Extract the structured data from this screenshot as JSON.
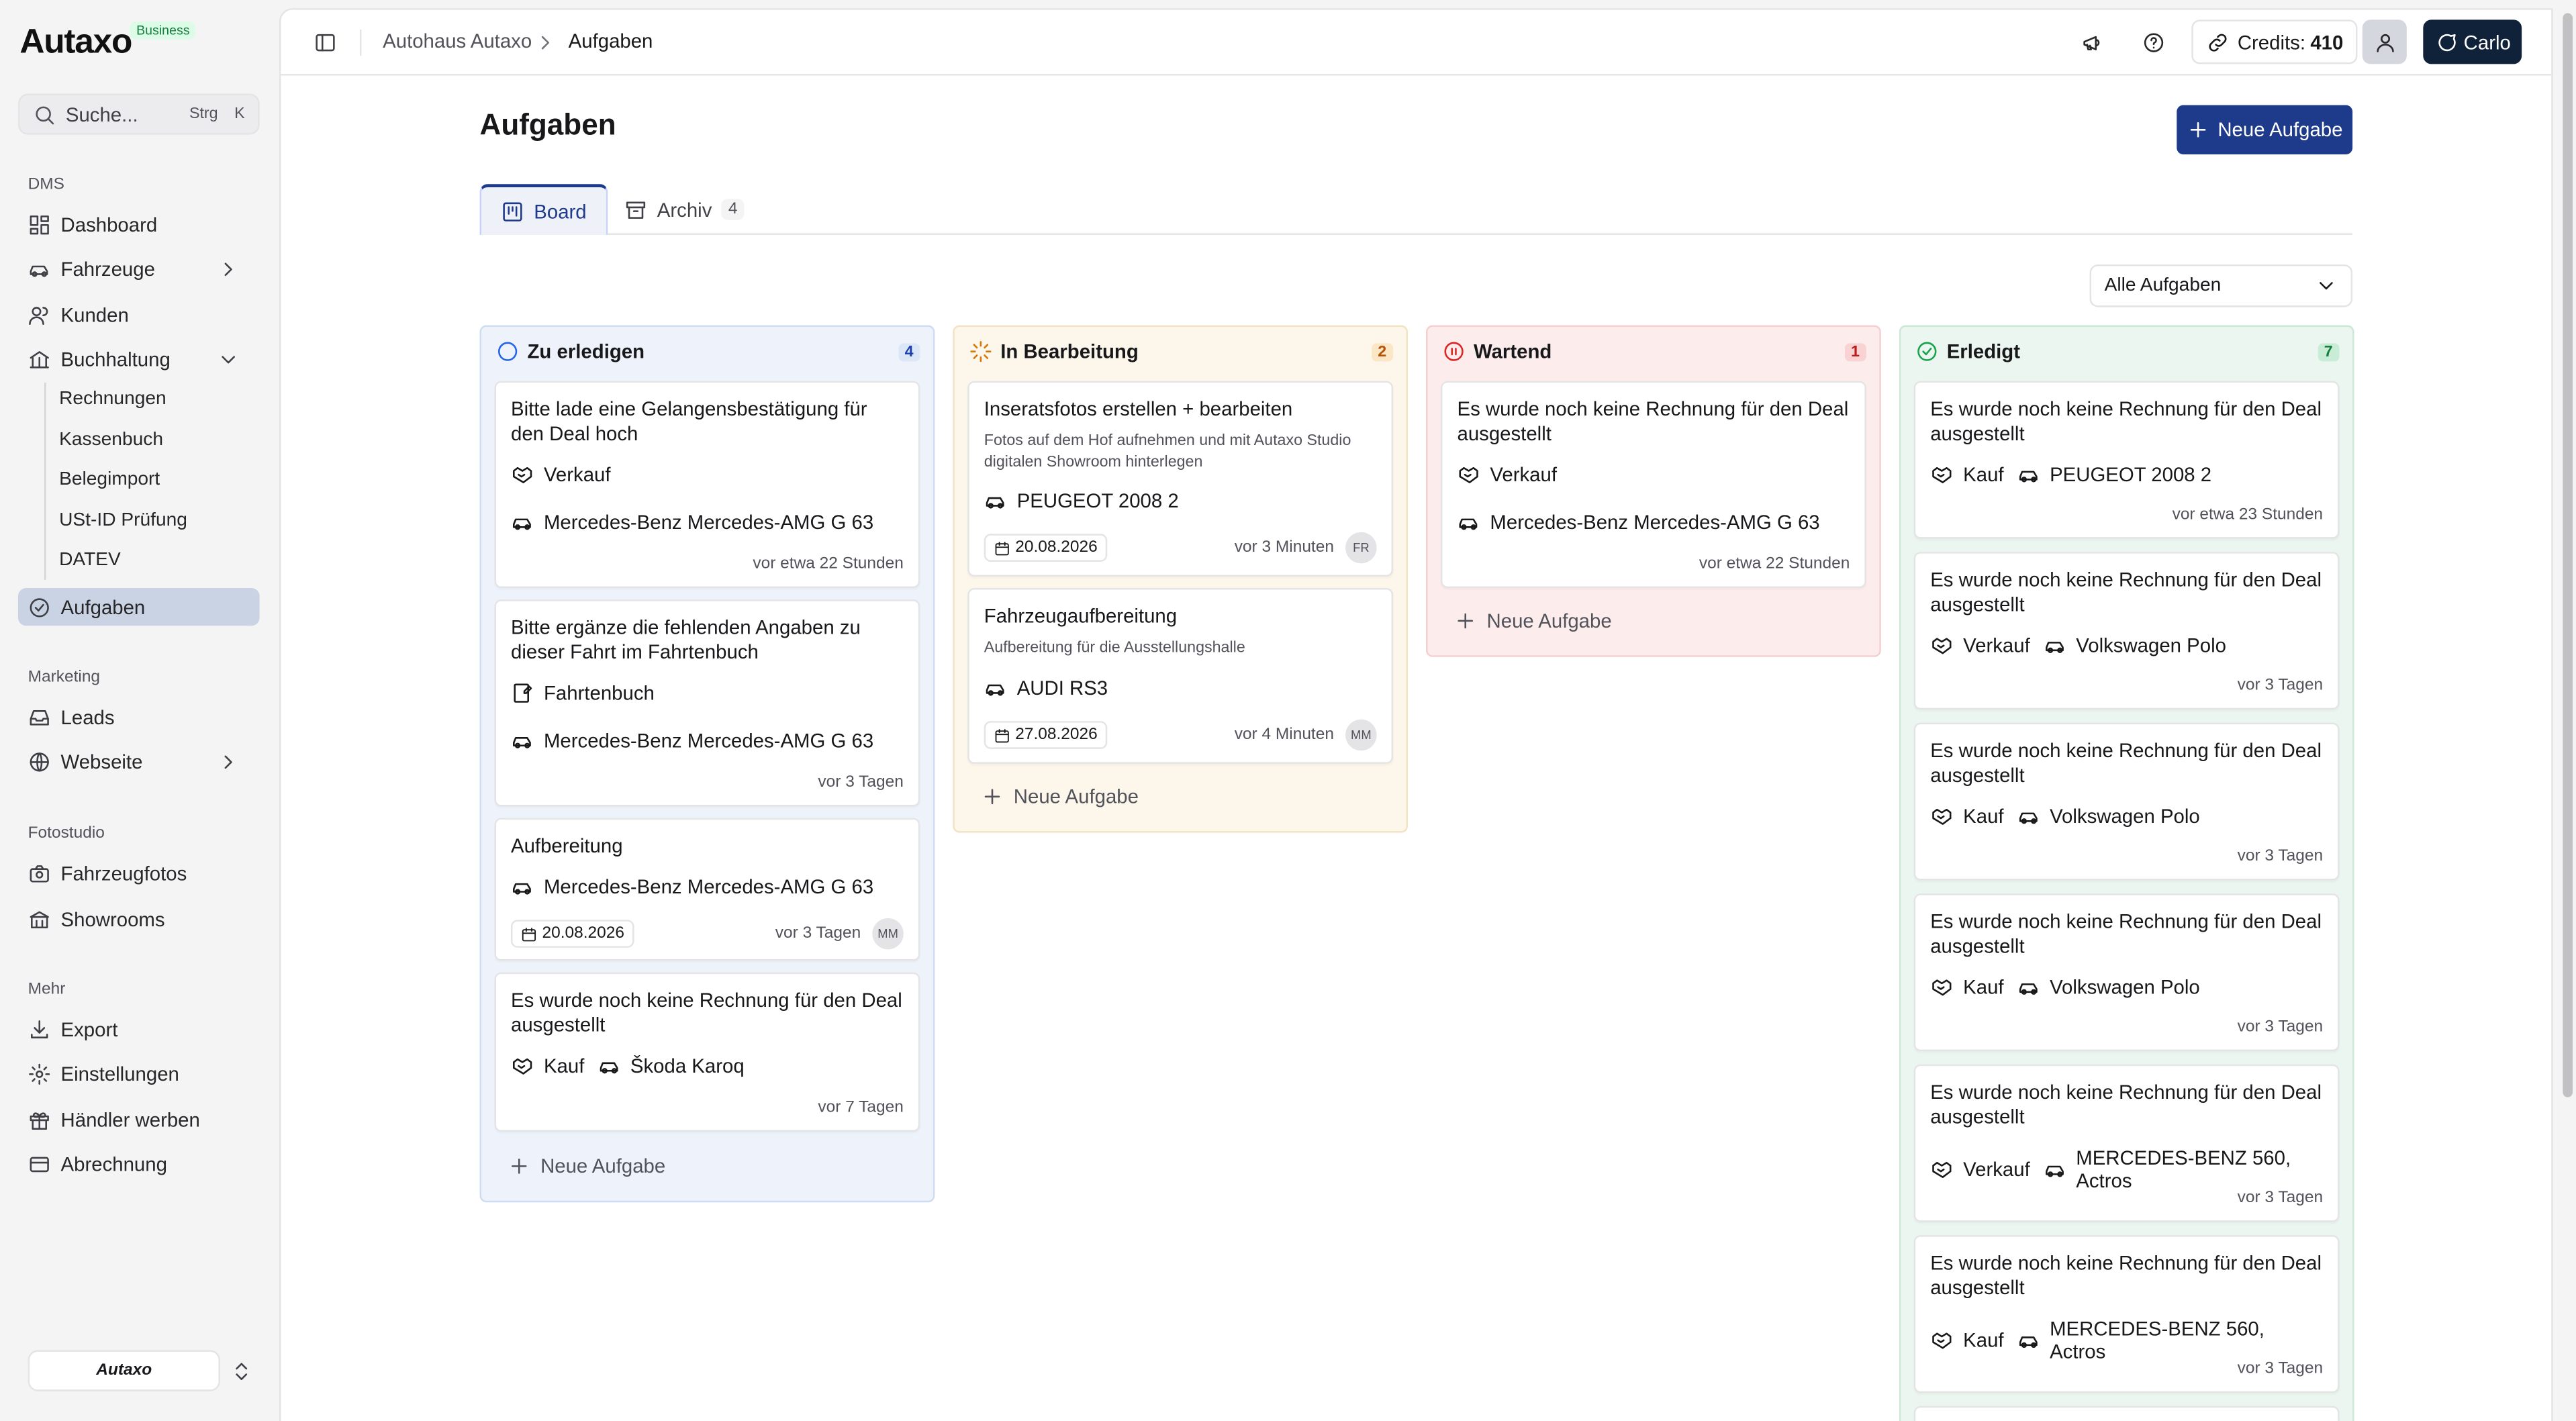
{
  "app": {
    "logo_text": "Autaxo",
    "plan_badge": "Business"
  },
  "search": {
    "placeholder": "Suche...",
    "shortcut_mod": "Strg",
    "shortcut_key": "K"
  },
  "sidebar": {
    "sections": [
      {
        "title": "DMS"
      },
      {
        "title": "Marketing"
      },
      {
        "title": "Fotostudio"
      },
      {
        "title": "Mehr"
      }
    ],
    "items": [
      {
        "label": "Dashboard",
        "icon": "dashboard-icon"
      },
      {
        "label": "Fahrzeuge",
        "icon": "car-icon"
      },
      {
        "label": "Kunden",
        "icon": "users-icon"
      },
      {
        "label": "Buchhaltung",
        "icon": "bank-icon"
      },
      {
        "label": "Aufgaben",
        "icon": "check-circle-icon",
        "active": true
      },
      {
        "label": "Leads",
        "icon": "inbox-icon"
      },
      {
        "label": "Webseite",
        "icon": "globe-icon"
      },
      {
        "label": "Fahrzeugfotos",
        "icon": "camera-icon"
      },
      {
        "label": "Showrooms",
        "icon": "building-icon"
      },
      {
        "label": "Export",
        "icon": "download-icon"
      },
      {
        "label": "Einstellungen",
        "icon": "gear-icon"
      },
      {
        "label": "Händler werben",
        "icon": "gift-icon"
      },
      {
        "label": "Abrechnung",
        "icon": "card-icon"
      }
    ],
    "sub_items": [
      "Rechnungen",
      "Kassenbuch",
      "Belegimport",
      "USt-ID Prüfung",
      "DATEV"
    ],
    "org_name": "Autaxo"
  },
  "header": {
    "breadcrumb": [
      "Autohaus Autaxo",
      "Aufgaben"
    ],
    "credits_label": "Credits:",
    "credits_value": "410",
    "user_name": "Carlo"
  },
  "page": {
    "title": "Aufgaben",
    "new_task_label": "Neue Aufgabe",
    "tabs": [
      {
        "label": "Board"
      },
      {
        "label": "Archiv",
        "count": "4"
      }
    ],
    "filter_value": "Alle Aufgaben",
    "add_task_label": "Neue Aufgabe"
  },
  "columns": [
    {
      "title": "Zu erledigen",
      "count": "4",
      "cards": [
        {
          "title": "Bitte lade eine Gelangensbestätigung für den Deal hoch",
          "deal": "Verkauf",
          "vehicle": "Mercedes-Benz Mercedes-AMG G 63",
          "time": "vor etwa 22 Stunden"
        },
        {
          "title": "Bitte ergänze die fehlenden Angaben zu dieser Fahrt im Fahrtenbuch",
          "deal": "Fahrtenbuch",
          "vehicle": "Mercedes-Benz Mercedes-AMG G 63",
          "time": "vor 3 Tagen"
        },
        {
          "title": "Aufbereitung",
          "vehicle": "Mercedes-Benz Mercedes-AMG G 63",
          "date": "20.08.2026",
          "time": "vor 3 Tagen",
          "assignee": "MM"
        },
        {
          "title": "Es wurde noch keine Rechnung für den Deal ausgestellt",
          "deal": "Kauf",
          "vehicle": "Škoda Karoq",
          "time": "vor 7 Tagen"
        }
      ]
    },
    {
      "title": "In Bearbeitung",
      "count": "2",
      "cards": [
        {
          "title": "Inseratsfotos erstellen + bearbeiten",
          "desc": "Fotos auf dem Hof aufnehmen und mit Autaxo Studio digitalen Showroom hinterlegen",
          "vehicle": "PEUGEOT 2008 2",
          "date": "20.08.2026",
          "time": "vor 3 Minuten",
          "assignee": "FR"
        },
        {
          "title": "Fahrzeugaufbereitung",
          "desc": "Aufbereitung für die Ausstellungshalle",
          "vehicle": "AUDI RS3",
          "date": "27.08.2026",
          "time": "vor 4 Minuten",
          "assignee": "MM"
        }
      ]
    },
    {
      "title": "Wartend",
      "count": "1",
      "cards": [
        {
          "title": "Es wurde noch keine Rechnung für den Deal ausgestellt",
          "deal": "Verkauf",
          "vehicle": "Mercedes-Benz Mercedes-AMG G 63",
          "time": "vor etwa 22 Stunden"
        }
      ]
    },
    {
      "title": "Erledigt",
      "count": "7",
      "cards": [
        {
          "title": "Es wurde noch keine Rechnung für den Deal ausgestellt",
          "deal": "Kauf",
          "vehicle": "PEUGEOT 2008 2",
          "time": "vor etwa 23 Stunden"
        },
        {
          "title": "Es wurde noch keine Rechnung für den Deal ausgestellt",
          "deal": "Verkauf",
          "vehicle": "Volkswagen Polo",
          "time": "vor 3 Tagen"
        },
        {
          "title": "Es wurde noch keine Rechnung für den Deal ausgestellt",
          "deal": "Kauf",
          "vehicle": "Volkswagen Polo",
          "time": "vor 3 Tagen"
        },
        {
          "title": "Es wurde noch keine Rechnung für den Deal ausgestellt",
          "deal": "Kauf",
          "vehicle": "Volkswagen Polo",
          "time": "vor 3 Tagen"
        },
        {
          "title": "Es wurde noch keine Rechnung für den Deal ausgestellt",
          "deal": "Verkauf",
          "vehicle": "MERCEDES-BENZ 560, Actros",
          "time": "vor 3 Tagen"
        },
        {
          "title": "Es wurde noch keine Rechnung für den Deal ausgestellt",
          "deal": "Kauf",
          "vehicle": "MERCEDES-BENZ 560, Actros",
          "time": "vor 3 Tagen"
        }
      ]
    }
  ],
  "colors": {
    "primary": "#1e3a8a",
    "todo_bg": "#eef3fb",
    "todo_border": "#cddcf1",
    "todo_accent": "#2563eb",
    "progress_bg": "#fdf6ea",
    "progress_border": "#f3e3c3",
    "progress_accent": "#d97706",
    "waiting_bg": "#fcecec",
    "waiting_border": "#f3cfcf",
    "waiting_accent": "#dc2626",
    "done_bg": "#eaf6ef",
    "done_border": "#cbe8d7",
    "done_accent": "#16a34a"
  }
}
